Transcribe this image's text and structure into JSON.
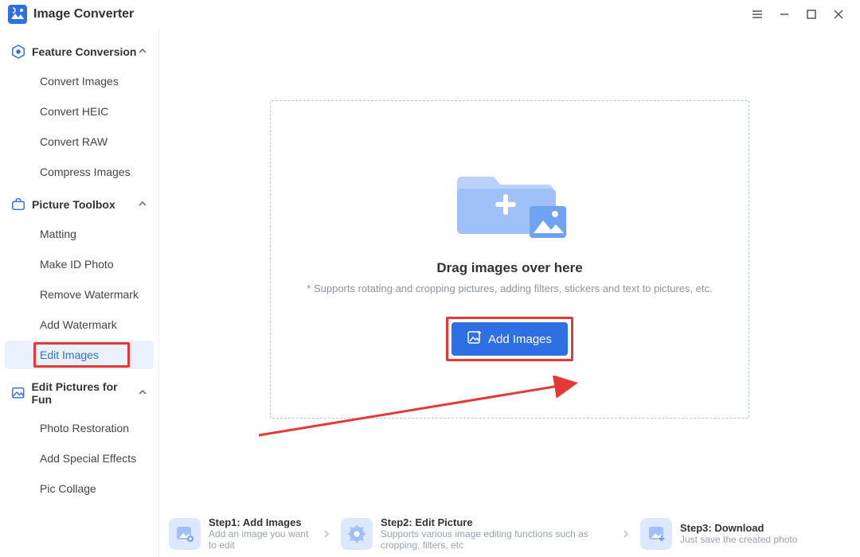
{
  "app": {
    "title": "Image Converter"
  },
  "sidebar": {
    "sections": [
      {
        "label": "Feature Conversion",
        "items": [
          "Convert Images",
          "Convert HEIC",
          "Convert RAW",
          "Compress Images"
        ]
      },
      {
        "label": "Picture Toolbox",
        "items": [
          "Matting",
          "Make ID Photo",
          "Remove Watermark",
          "Add Watermark",
          "Edit Images"
        ]
      },
      {
        "label": "Edit Pictures for Fun",
        "items": [
          "Photo Restoration",
          "Add Special Effects",
          "Pic Collage"
        ]
      }
    ],
    "active": "Edit Images"
  },
  "dropzone": {
    "title": "Drag images over here",
    "subtitle": "* Supports rotating and cropping pictures, adding filters, stickers and text to pictures, etc.",
    "button": "Add Images"
  },
  "steps": [
    {
      "title": "Step1:  Add Images",
      "sub": "Add an image you want to edit"
    },
    {
      "title": "Step2:  Edit Picture",
      "sub": "Supports various image editing functions such as cropping, filters, etc"
    },
    {
      "title": "Step3:  Download",
      "sub": "Just save the created photo"
    }
  ]
}
